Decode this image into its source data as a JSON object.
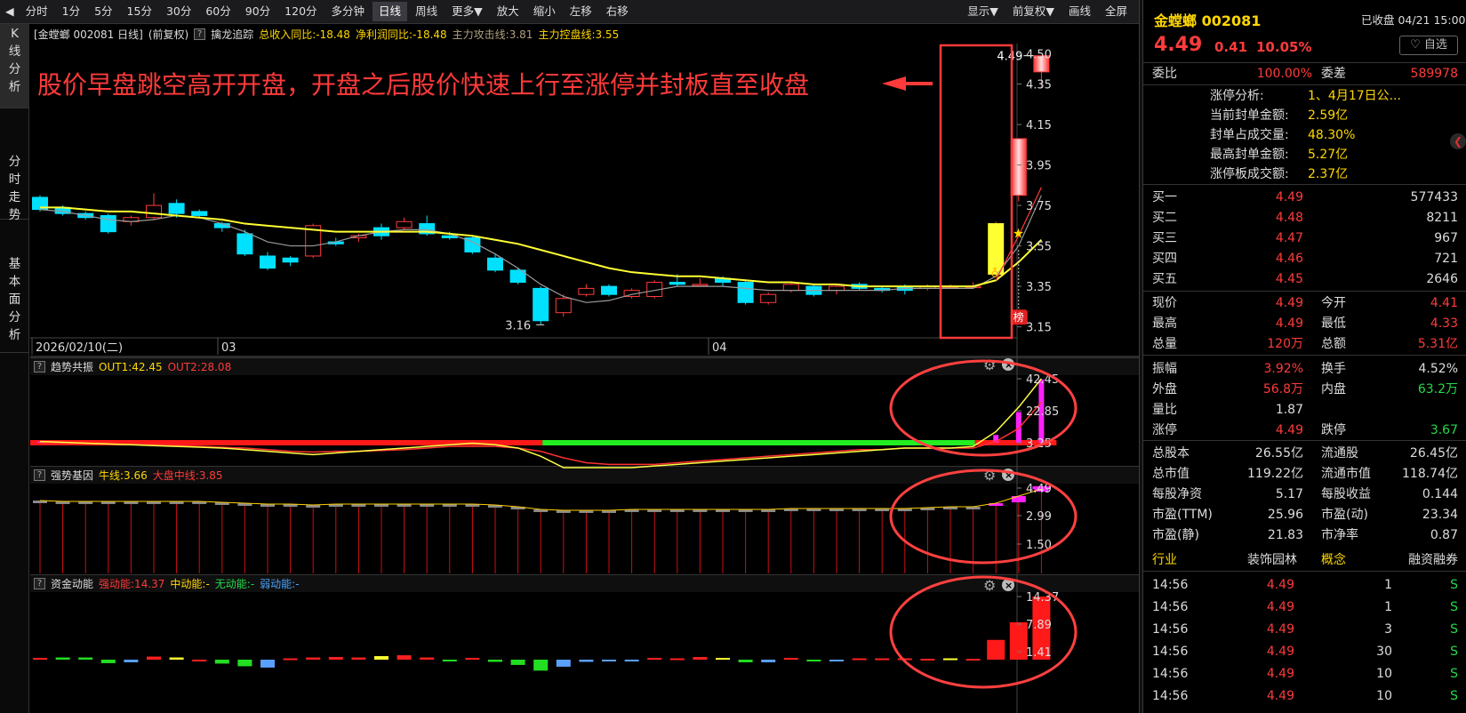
{
  "toolbar": {
    "items": [
      "分时",
      "1分",
      "5分",
      "15分",
      "30分",
      "60分",
      "90分",
      "120分",
      "多分钟",
      "日线",
      "周线",
      "更多▼",
      "放大",
      "缩小",
      "左移",
      "右移"
    ],
    "right_items": [
      "显示▼",
      "前复权▼",
      "画线",
      "全屏"
    ],
    "active": "日线"
  },
  "left_tabs": [
    [
      "K",
      "线",
      "分",
      "析"
    ],
    [
      "分",
      "时",
      "走",
      "势"
    ],
    [
      "基",
      "本",
      "面",
      "分",
      "析"
    ]
  ],
  "info": {
    "name": "[金螳螂 002081 日线]",
    "adj": "(前复权)",
    "indicator": "擒龙追踪",
    "rev": "总收入同比:-18.48",
    "profit": "净利润同比:-18.48",
    "attack": "主力攻击线:3.81",
    "control": "主力控盘线:3.55"
  },
  "annotation": "股价早盘跳空高开开盘，开盘之后股价快速上行至涨停并封板直至收盘",
  "main_chart": {
    "y_ticks": [
      "4.50",
      "4.35",
      "4.15",
      "3.95",
      "3.75",
      "3.55",
      "3.35",
      "3.15"
    ],
    "x_labels": [
      "2026/02/10(二)",
      "03",
      "04"
    ],
    "low_label": "3.16",
    "high_label": "4.49",
    "badge": "榜"
  },
  "chart_data": {
    "type": "candlestick",
    "ylim": [
      3.1,
      4.55
    ],
    "candles": [
      [
        3.79,
        3.73,
        3.8,
        3.72
      ],
      [
        3.74,
        3.71,
        3.75,
        3.7
      ],
      [
        3.71,
        3.69,
        3.72,
        3.68
      ],
      [
        3.7,
        3.62,
        3.71,
        3.61
      ],
      [
        3.67,
        3.69,
        3.7,
        3.65
      ],
      [
        3.69,
        3.75,
        3.81,
        3.68
      ],
      [
        3.76,
        3.71,
        3.78,
        3.69
      ],
      [
        3.72,
        3.7,
        3.73,
        3.69
      ],
      [
        3.66,
        3.64,
        3.67,
        3.62
      ],
      [
        3.61,
        3.51,
        3.63,
        3.5
      ],
      [
        3.5,
        3.44,
        3.52,
        3.43
      ],
      [
        3.49,
        3.47,
        3.5,
        3.45
      ],
      [
        3.5,
        3.65,
        3.66,
        3.49
      ],
      [
        3.57,
        3.56,
        3.59,
        3.55
      ],
      [
        3.59,
        3.6,
        3.61,
        3.57
      ],
      [
        3.64,
        3.6,
        3.66,
        3.58
      ],
      [
        3.64,
        3.67,
        3.69,
        3.63
      ],
      [
        3.66,
        3.61,
        3.7,
        3.6
      ],
      [
        3.6,
        3.59,
        3.62,
        3.58
      ],
      [
        3.59,
        3.52,
        3.6,
        3.51
      ],
      [
        3.49,
        3.43,
        3.51,
        3.42
      ],
      [
        3.43,
        3.37,
        3.44,
        3.36
      ],
      [
        3.34,
        3.18,
        3.35,
        3.16
      ],
      [
        3.22,
        3.29,
        3.31,
        3.2
      ],
      [
        3.31,
        3.34,
        3.36,
        3.3
      ],
      [
        3.35,
        3.31,
        3.36,
        3.3
      ],
      [
        3.3,
        3.33,
        3.34,
        3.29
      ],
      [
        3.3,
        3.37,
        3.38,
        3.29
      ],
      [
        3.37,
        3.36,
        3.41,
        3.35
      ],
      [
        3.36,
        3.36,
        3.39,
        3.35
      ],
      [
        3.39,
        3.37,
        3.4,
        3.35
      ],
      [
        3.37,
        3.27,
        3.38,
        3.26
      ],
      [
        3.27,
        3.31,
        3.32,
        3.26
      ],
      [
        3.33,
        3.36,
        3.37,
        3.32
      ],
      [
        3.35,
        3.31,
        3.36,
        3.3
      ],
      [
        3.33,
        3.35,
        3.36,
        3.31
      ],
      [
        3.36,
        3.34,
        3.37,
        3.33
      ],
      [
        3.34,
        3.33,
        3.35,
        3.32
      ],
      [
        3.35,
        3.33,
        3.36,
        3.31
      ],
      [
        3.34,
        3.35,
        3.36,
        3.33
      ],
      [
        3.35,
        3.35,
        3.36,
        3.34
      ],
      [
        3.35,
        3.35,
        3.37,
        3.34
      ],
      [
        3.41,
        3.66,
        3.67,
        3.4
      ],
      [
        3.8,
        4.08,
        4.08,
        3.77
      ],
      [
        4.41,
        4.49,
        4.49,
        4.33
      ]
    ],
    "ma_yellow": [
      3.74,
      3.74,
      3.73,
      3.72,
      3.72,
      3.71,
      3.7,
      3.69,
      3.68,
      3.66,
      3.65,
      3.64,
      3.63,
      3.62,
      3.62,
      3.62,
      3.62,
      3.62,
      3.61,
      3.6,
      3.58,
      3.56,
      3.53,
      3.5,
      3.47,
      3.44,
      3.42,
      3.41,
      3.4,
      3.4,
      3.39,
      3.38,
      3.37,
      3.37,
      3.36,
      3.36,
      3.35,
      3.35,
      3.35,
      3.35,
      3.35,
      3.35,
      3.38,
      3.47,
      3.58
    ],
    "ma_gray": [
      3.73,
      3.72,
      3.7,
      3.68,
      3.67,
      3.68,
      3.7,
      3.69,
      3.66,
      3.62,
      3.57,
      3.55,
      3.55,
      3.57,
      3.6,
      3.62,
      3.63,
      3.63,
      3.61,
      3.57,
      3.51,
      3.44,
      3.36,
      3.3,
      3.27,
      3.28,
      3.31,
      3.33,
      3.35,
      3.35,
      3.35,
      3.34,
      3.33,
      3.33,
      3.33,
      3.33,
      3.33,
      3.33,
      3.34,
      3.34,
      3.34,
      3.34,
      3.4,
      3.55,
      3.8
    ]
  },
  "ind1": {
    "name": "趋势共振",
    "out1": "OUT1:42.45",
    "out2": "OUT2:28.08",
    "ticks": [
      "42.45",
      "22.85",
      "3.25"
    ],
    "ylim": [
      0,
      45
    ],
    "out1_vals": [
      4,
      3.5,
      3,
      2.5,
      2,
      1.5,
      1,
      0.5,
      0,
      -1,
      -2,
      -3,
      -4,
      -3,
      -2,
      -1,
      0,
      1,
      2,
      3,
      2,
      0,
      -5,
      -12,
      -12,
      -12,
      -12,
      -11,
      -10,
      -9,
      -8,
      -7,
      -6,
      -5,
      -4,
      -3,
      -2,
      -1,
      0,
      0,
      0,
      1,
      10,
      25,
      42.45
    ],
    "out2_vals": [
      3,
      3,
      3,
      2.5,
      2,
      2,
      1.5,
      1,
      0.5,
      0,
      -1,
      -2,
      -2.5,
      -2,
      -2,
      -1.5,
      -1,
      0,
      1,
      1,
      1,
      0,
      -2,
      -6,
      -9,
      -10,
      -10,
      -10,
      -9,
      -8,
      -7,
      -6,
      -5,
      -4,
      -3,
      -2,
      -1,
      -1,
      0,
      0,
      0,
      0,
      4,
      12,
      28.08
    ],
    "bars": [
      4,
      0,
      0,
      0,
      0,
      0,
      0,
      0,
      0,
      0,
      0,
      0,
      0,
      0,
      0,
      0,
      0,
      0,
      0,
      0,
      0,
      0,
      0,
      0,
      0,
      0,
      0,
      0,
      0,
      0,
      0,
      0,
      0,
      0,
      0,
      0,
      0,
      0,
      0,
      0,
      0,
      0,
      8,
      22,
      42
    ]
  },
  "ind2": {
    "name": "强势基因",
    "bull": "牛线:3.66",
    "market": "大盘中线:3.85",
    "ticks": [
      "4.49",
      "2.99",
      "1.50"
    ],
    "ylim": [
      0.5,
      5.0
    ]
  },
  "ind3": {
    "name": "资金动能",
    "strong": "强动能:14.37",
    "mid": "中动能:-",
    "none": "无动能:-",
    "weak": "弱动能:-",
    "ticks": [
      "14.37",
      "7.89",
      "1.41"
    ],
    "values": [
      0.4,
      0.5,
      0.5,
      -0.8,
      -0.6,
      0.7,
      0.5,
      -0.4,
      -0.9,
      -1.5,
      -1.8,
      0.3,
      0.5,
      0.6,
      0.5,
      0.8,
      1.0,
      0.5,
      -0.4,
      0.4,
      -0.5,
      -1.2,
      -2.5,
      -1.6,
      -0.5,
      -0.3,
      -0.3,
      0.4,
      0.3,
      0.6,
      0.4,
      -0.6,
      -0.6,
      0.4,
      -0.4,
      -0.3,
      0.3,
      0.3,
      0.3,
      0.2,
      0.3,
      0.2,
      4.5,
      8.5,
      14.37
    ]
  },
  "right": {
    "title": "金螳螂 002081",
    "status": "已收盘 04/21 15:00",
    "price": "4.49",
    "change": "0.41",
    "pct": "10.05%",
    "watch": "♡ 自选",
    "weibi_label": "委比",
    "weibi": "100.00%",
    "weicha_label": "委差",
    "weicha": "589978",
    "limit_info": [
      [
        "涨停分析:",
        "1、4月17日公..."
      ],
      [
        "当前封单金额:",
        "2.59亿"
      ],
      [
        "封单占成交量:",
        "48.30%"
      ],
      [
        "最高封单金额:",
        "5.27亿"
      ],
      [
        "涨停板成交额:",
        "2.37亿"
      ]
    ],
    "bids": [
      [
        "买一",
        "4.49",
        "577433"
      ],
      [
        "买二",
        "4.48",
        "8211"
      ],
      [
        "买三",
        "4.47",
        "967"
      ],
      [
        "买四",
        "4.46",
        "721"
      ],
      [
        "买五",
        "4.45",
        "2646"
      ]
    ],
    "stats1": [
      [
        "现价",
        "4.49",
        "今开",
        "4.41"
      ],
      [
        "最高",
        "4.49",
        "最低",
        "4.33"
      ],
      [
        "总量",
        "120万",
        "总额",
        "5.31亿"
      ]
    ],
    "stats2": [
      [
        "振幅",
        "3.92%",
        "换手",
        "4.52%"
      ],
      [
        "外盘",
        "56.8万",
        "内盘",
        "63.2万"
      ],
      [
        "量比",
        "1.87",
        "",
        ""
      ],
      [
        "涨停",
        "4.49",
        "跌停",
        "3.67"
      ]
    ],
    "stats3": [
      [
        "总股本",
        "26.55亿",
        "流通股",
        "26.45亿"
      ],
      [
        "总市值",
        "119.22亿",
        "流通市值",
        "118.74亿"
      ],
      [
        "每股净资",
        "5.17",
        "每股收益",
        "0.144"
      ],
      [
        "市盈(TTM)",
        "25.96",
        "市盈(动)",
        "23.34"
      ],
      [
        "市盈(静)",
        "21.83",
        "市净率",
        "0.87"
      ]
    ],
    "industry": [
      "行业",
      "装饰园林",
      "概念",
      "融资融券"
    ],
    "ticks": [
      [
        "14:56",
        "4.49",
        "1",
        "S"
      ],
      [
        "14:56",
        "4.49",
        "1",
        "S"
      ],
      [
        "14:56",
        "4.49",
        "3",
        "S"
      ],
      [
        "14:56",
        "4.49",
        "30",
        "S"
      ],
      [
        "14:56",
        "4.49",
        "10",
        "S"
      ],
      [
        "14:56",
        "4.49",
        "10",
        "S"
      ]
    ]
  },
  "colors": {
    "up": "#ff3b3b",
    "down": "#00e0ff",
    "ma_yellow": "#ffff33",
    "ma_gray": "#9a9a9a",
    "annotation": "#ff3a3a",
    "magenta": "#ff22ff",
    "green": "#22ee22"
  }
}
